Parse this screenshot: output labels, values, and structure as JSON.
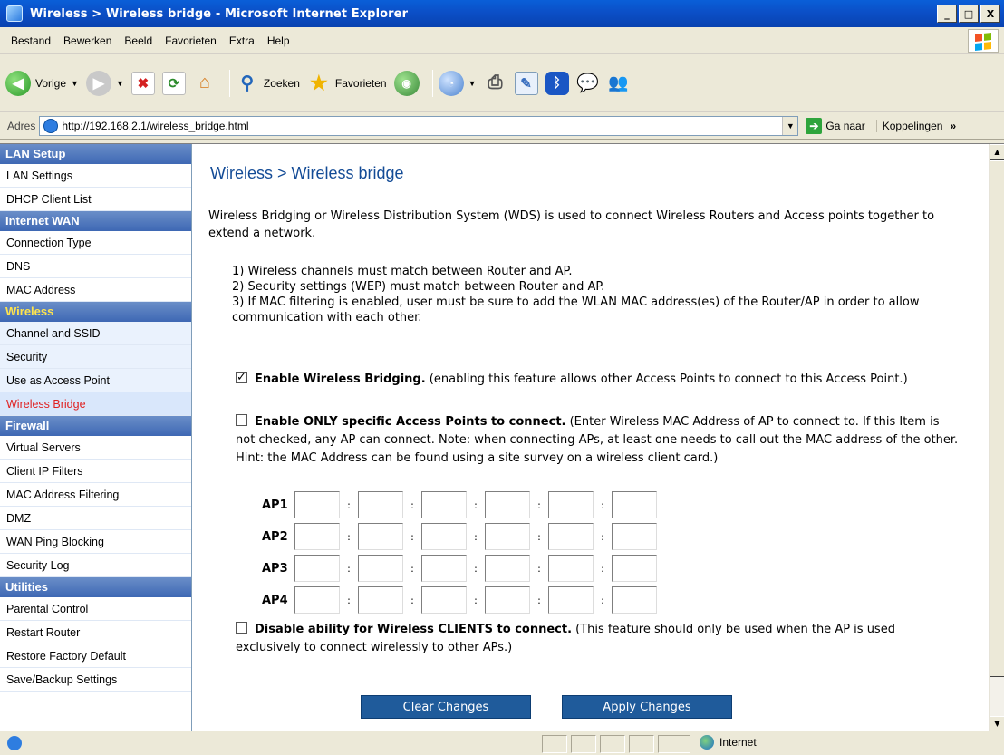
{
  "window": {
    "title": "Wireless > Wireless bridge - Microsoft Internet Explorer",
    "controls": [
      "_",
      "□",
      "X"
    ]
  },
  "menu": [
    "Bestand",
    "Bewerken",
    "Beeld",
    "Favorieten",
    "Extra",
    "Help"
  ],
  "toolbar": {
    "back": "Vorige",
    "search": "Zoeken",
    "favorites": "Favorieten"
  },
  "address": {
    "label": "Adres",
    "url": "http://192.168.2.1/wireless_bridge.html",
    "go": "Ga naar",
    "links": "Koppelingen",
    "more": "»"
  },
  "sidebar": {
    "sections": [
      {
        "title": "LAN Setup",
        "items": [
          "LAN Settings",
          "DHCP Client List"
        ]
      },
      {
        "title": "Internet WAN",
        "items": [
          "Connection Type",
          "DNS",
          "MAC Address"
        ]
      },
      {
        "title": "Wireless",
        "items": [
          "Channel and SSID",
          "Security",
          "Use as Access Point",
          "Wireless Bridge"
        ]
      },
      {
        "title": "Firewall",
        "items": [
          "Virtual Servers",
          "Client IP Filters",
          "MAC Address Filtering",
          "DMZ",
          "WAN Ping Blocking",
          "Security Log"
        ]
      },
      {
        "title": "Utilities",
        "items": [
          "Parental Control",
          "Restart Router",
          "Restore Factory Default",
          "Save/Backup Settings"
        ]
      }
    ],
    "active_item": "Wireless Bridge"
  },
  "main": {
    "title": "Wireless > Wireless bridge",
    "intro": "Wireless Bridging or Wireless Distribution System (WDS) is used to connect Wireless Routers and Access points together to extend a network.",
    "rule1": "1) Wireless channels must match between Router and AP.",
    "rule2": "2) Security settings (WEP) must match between Router and AP.",
    "rule3": "3) If MAC filtering is enabled, user must be sure to add the WLAN MAC address(es) of the Router/AP in order to allow communication with each other.",
    "opt1_title": "Enable Wireless Bridging.",
    "opt1_desc": " (enabling this feature allows other Access Points to connect to this Access Point.)",
    "opt1_checked": true,
    "opt2_title": "Enable ONLY specific Access Points to connect.",
    "opt2_desc": " (Enter Wireless MAC Address of AP to connect to. If this Item is not checked, any AP can connect. Note: when connecting APs, at least one needs to call out the MAC address of the other. Hint: the MAC Address can be found using a site survey on a wireless client card.)",
    "opt2_checked": false,
    "ap_labels": [
      "AP1",
      "AP2",
      "AP3",
      "AP4"
    ],
    "separator": ":",
    "opt3_title": "Disable ability for Wireless CLIENTS to connect.",
    "opt3_desc": " (This feature should only be used when the AP is used exclusively to connect wirelessly to other APs.)",
    "opt3_checked": false,
    "clear_btn": "Clear Changes",
    "apply_btn": "Apply Changes"
  },
  "status": {
    "zone": "Internet"
  }
}
